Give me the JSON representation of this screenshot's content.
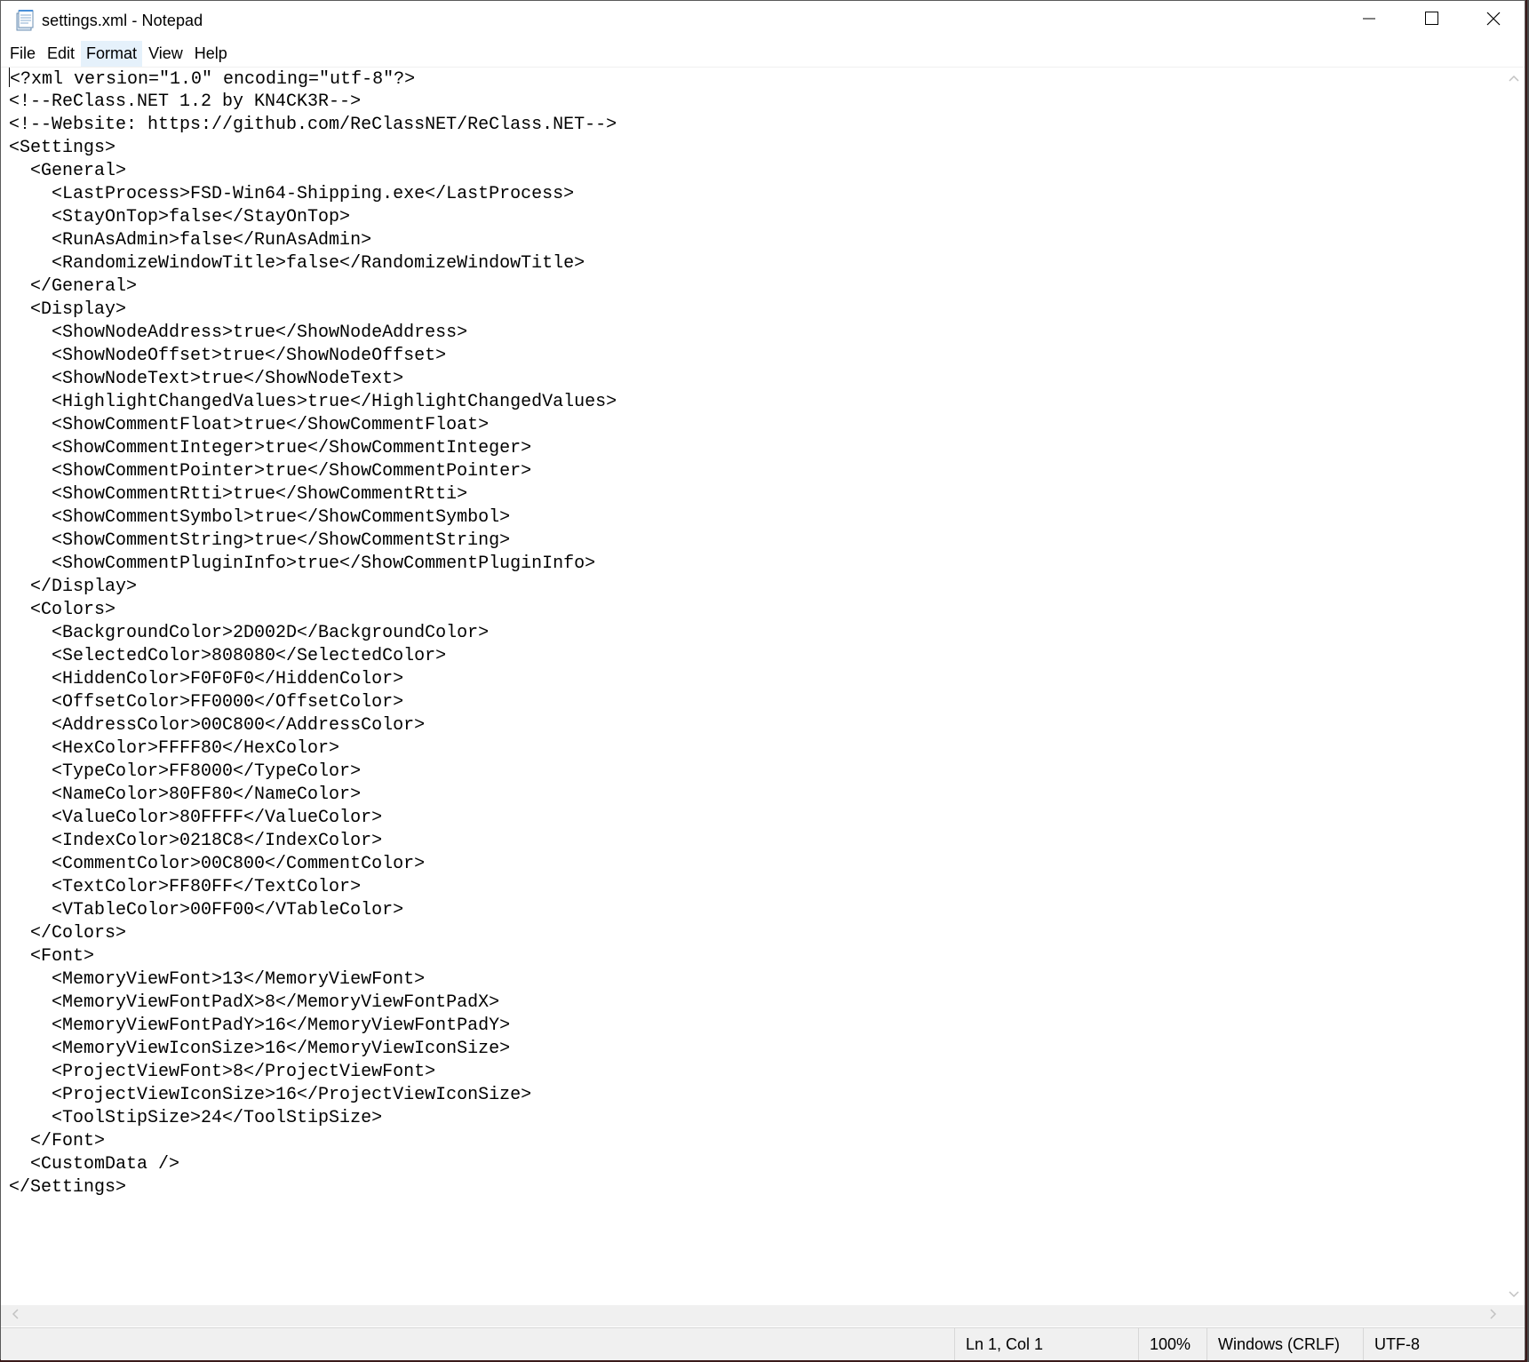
{
  "window": {
    "title": "settings.xml - Notepad",
    "icon": "notepad-icon",
    "controls": {
      "minimize_icon": "minimize-icon",
      "maximize_icon": "maximize-icon",
      "close_icon": "close-icon"
    }
  },
  "menu": {
    "items": [
      {
        "label": "File"
      },
      {
        "label": "Edit"
      },
      {
        "label": "Format",
        "active": true
      },
      {
        "label": "View"
      },
      {
        "label": "Help"
      }
    ]
  },
  "editor": {
    "lines": [
      "<?xml version=\"1.0\" encoding=\"utf-8\"?>",
      "<!--ReClass.NET 1.2 by KN4CK3R-->",
      "<!--Website: https://github.com/ReClassNET/ReClass.NET-->",
      "<Settings>",
      "  <General>",
      "    <LastProcess>FSD-Win64-Shipping.exe</LastProcess>",
      "    <StayOnTop>false</StayOnTop>",
      "    <RunAsAdmin>false</RunAsAdmin>",
      "    <RandomizeWindowTitle>false</RandomizeWindowTitle>",
      "  </General>",
      "  <Display>",
      "    <ShowNodeAddress>true</ShowNodeAddress>",
      "    <ShowNodeOffset>true</ShowNodeOffset>",
      "    <ShowNodeText>true</ShowNodeText>",
      "    <HighlightChangedValues>true</HighlightChangedValues>",
      "    <ShowCommentFloat>true</ShowCommentFloat>",
      "    <ShowCommentInteger>true</ShowCommentInteger>",
      "    <ShowCommentPointer>true</ShowCommentPointer>",
      "    <ShowCommentRtti>true</ShowCommentRtti>",
      "    <ShowCommentSymbol>true</ShowCommentSymbol>",
      "    <ShowCommentString>true</ShowCommentString>",
      "    <ShowCommentPluginInfo>true</ShowCommentPluginInfo>",
      "  </Display>",
      "  <Colors>",
      "    <BackgroundColor>2D002D</BackgroundColor>",
      "    <SelectedColor>808080</SelectedColor>",
      "    <HiddenColor>F0F0F0</HiddenColor>",
      "    <OffsetColor>FF0000</OffsetColor>",
      "    <AddressColor>00C800</AddressColor>",
      "    <HexColor>FFFF80</HexColor>",
      "    <TypeColor>FF8000</TypeColor>",
      "    <NameColor>80FF80</NameColor>",
      "    <ValueColor>80FFFF</ValueColor>",
      "    <IndexColor>0218C8</IndexColor>",
      "    <CommentColor>00C800</CommentColor>",
      "    <TextColor>FF80FF</TextColor>",
      "    <VTableColor>00FF00</VTableColor>",
      "  </Colors>",
      "  <Font>",
      "    <MemoryViewFont>13</MemoryViewFont>",
      "    <MemoryViewFontPadX>8</MemoryViewFontPadX>",
      "    <MemoryViewFontPadY>16</MemoryViewFontPadY>",
      "    <MemoryViewIconSize>16</MemoryViewIconSize>",
      "    <ProjectViewFont>8</ProjectViewFont>",
      "    <ProjectViewIconSize>16</ProjectViewIconSize>",
      "    <ToolStipSize>24</ToolStipSize>",
      "  </Font>",
      "  <CustomData />",
      "</Settings>"
    ]
  },
  "status": {
    "position": "Ln 1, Col 1",
    "zoom": "100%",
    "line_ending": "Windows (CRLF)",
    "encoding": "UTF-8"
  }
}
